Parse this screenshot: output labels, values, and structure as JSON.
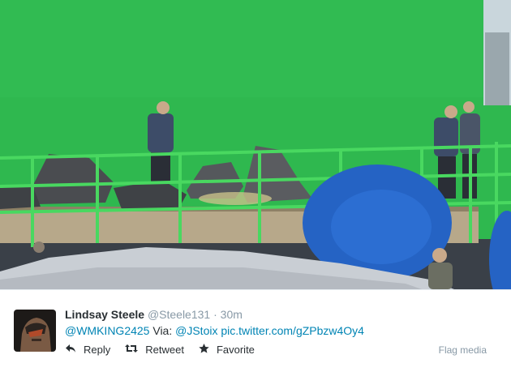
{
  "tweet": {
    "author_name": "Lindsay Steele",
    "author_handle": "@Steele131",
    "separator": "·",
    "time_ago": "30m",
    "mention": "@WMKING2425",
    "via_label": "Via:",
    "via_handle": "@JStoix",
    "link": "pic.twitter.com/gZPbzw4Oy4"
  },
  "actions": {
    "reply_label": "Reply",
    "retweet_label": "Retweet",
    "favorite_label": "Favorite",
    "flag_label": "Flag media"
  },
  "icons": {
    "reply": "reply-icon",
    "retweet": "retweet-icon",
    "favorite": "star-icon"
  },
  "colors": {
    "link": "#0084b4",
    "meta": "#8899a6",
    "text": "#292f33",
    "greenscreen": "#2fb84f"
  }
}
